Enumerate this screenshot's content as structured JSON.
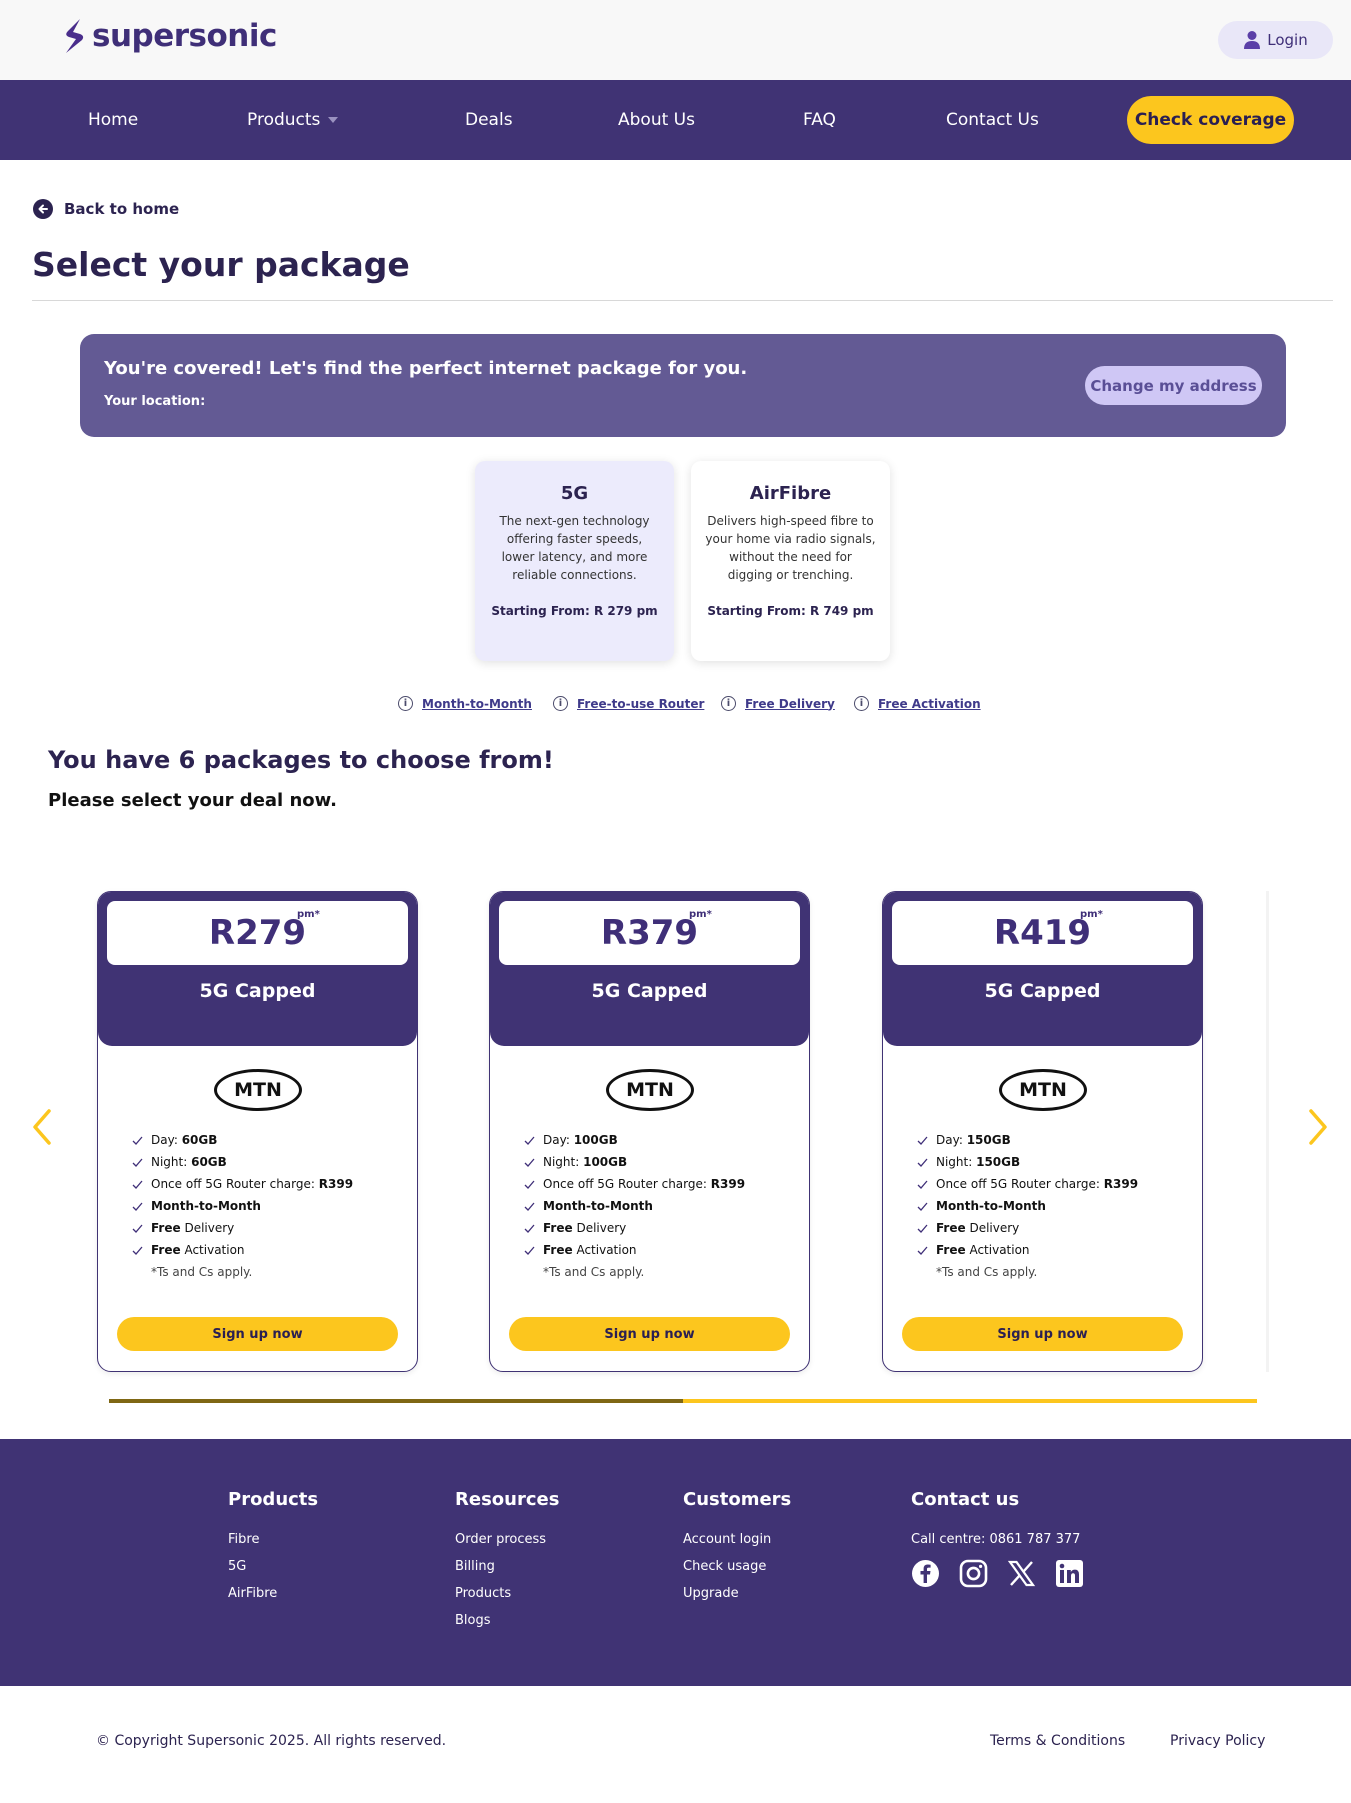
{
  "brand": {
    "name": "supersonic",
    "primary_color": "#403374",
    "accent_color": "#fcc61e"
  },
  "header": {
    "login_label": "Login"
  },
  "nav": {
    "items": [
      {
        "label": "Home"
      },
      {
        "label": "Products",
        "has_dropdown": true
      },
      {
        "label": "Deals"
      },
      {
        "label": "About Us"
      },
      {
        "label": "FAQ"
      },
      {
        "label": "Contact Us"
      }
    ],
    "cta_label": "Check coverage"
  },
  "page": {
    "back_label": "Back to home",
    "title": "Select your package"
  },
  "coverage": {
    "headline": "You're covered! Let's find the perfect internet package for you.",
    "location_label": "Your location:",
    "change_label": "Change my address"
  },
  "tech_options": [
    {
      "name": "5G",
      "description": "The next-gen technology offering faster speeds, lower latency, and more reliable connections.",
      "price": "Starting From: R 279 pm",
      "selected": true
    },
    {
      "name": "AirFibre",
      "description": "Delivers high-speed fibre to your home via radio signals, without the need for digging or trenching.",
      "price": "Starting From: R 749 pm",
      "selected": false
    }
  ],
  "info_links": [
    "Month-to-Month",
    "Free-to-use Router",
    "Free Delivery",
    "Free Activation"
  ],
  "packages_heading": "You have 6 packages to choose from!",
  "packages_subheading": "Please select your deal now.",
  "packages": [
    {
      "price": "R279",
      "pm": "pm*",
      "name": "5G Capped",
      "provider": "MTN",
      "day": "60GB",
      "night": "60GB",
      "router_label": "Once off 5G Router charge:",
      "router_charge": "R399",
      "cta": "Sign up now"
    },
    {
      "price": "R379",
      "pm": "pm*",
      "name": "5G Capped",
      "provider": "MTN",
      "day": "100GB",
      "night": "100GB",
      "router_label": "Once off 5G Router charge:",
      "router_charge": "R399",
      "cta": "Sign up now"
    },
    {
      "price": "R419",
      "pm": "pm*",
      "name": "5G Capped",
      "provider": "MTN",
      "day": "150GB",
      "night": "150GB",
      "router_label": "Once off 5G Router charge:",
      "router_charge": "R399",
      "cta": "Sign up now"
    }
  ],
  "feature_labels": {
    "day": "Day:",
    "night": "Night:",
    "month": "Month-to-Month",
    "free": "Free",
    "delivery": "Delivery",
    "activation": "Activation",
    "ts": "*Ts and Cs apply."
  },
  "carousel": {
    "progress": 0.5
  },
  "footer": {
    "columns": [
      {
        "title": "Products",
        "links": [
          "Fibre",
          "5G",
          "AirFibre"
        ]
      },
      {
        "title": "Resources",
        "links": [
          "Order process",
          "Billing",
          "Products",
          "Blogs"
        ]
      },
      {
        "title": "Customers",
        "links": [
          "Account login",
          "Check usage",
          "Upgrade"
        ]
      }
    ],
    "contact": {
      "title": "Contact us",
      "call_centre": "Call centre: 0861 787 377",
      "social_icons": [
        "facebook-icon",
        "instagram-icon",
        "x-icon",
        "linkedin-icon"
      ]
    },
    "copyright": "© Copyright Supersonic 2025. All rights reserved.",
    "terms": "Terms & Conditions",
    "privacy": "Privacy Policy"
  }
}
